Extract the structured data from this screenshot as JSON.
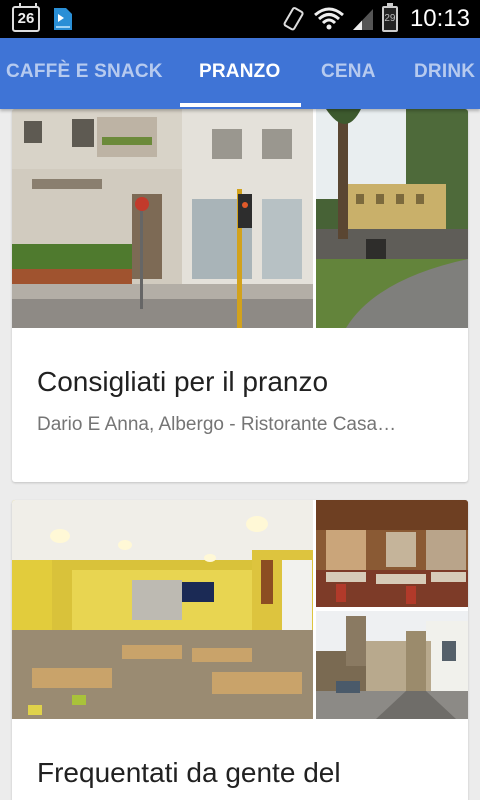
{
  "status_bar": {
    "calendar_day": "26",
    "battery_level": "29",
    "time": "10:13"
  },
  "tabs": [
    {
      "label": "CAFFÈ E SNACK",
      "active": false
    },
    {
      "label": "PRANZO",
      "active": true
    },
    {
      "label": "CENA",
      "active": false
    },
    {
      "label": "DRINK",
      "active": false
    }
  ],
  "colors": {
    "tab_bar": "#3f74d6",
    "background": "#ececec"
  },
  "cards": [
    {
      "title": "Consigliati per il pranzo",
      "subtitle": "Dario E Anna, Albergo - Ristorante Casa…",
      "photos": [
        "street-storefront-photo",
        "villa-driveway-photo"
      ]
    },
    {
      "title": "Frequentati da gente del",
      "photos": [
        "cafe-interior-photo",
        "restaurant-dining-photo",
        "street-view-photo"
      ]
    }
  ]
}
